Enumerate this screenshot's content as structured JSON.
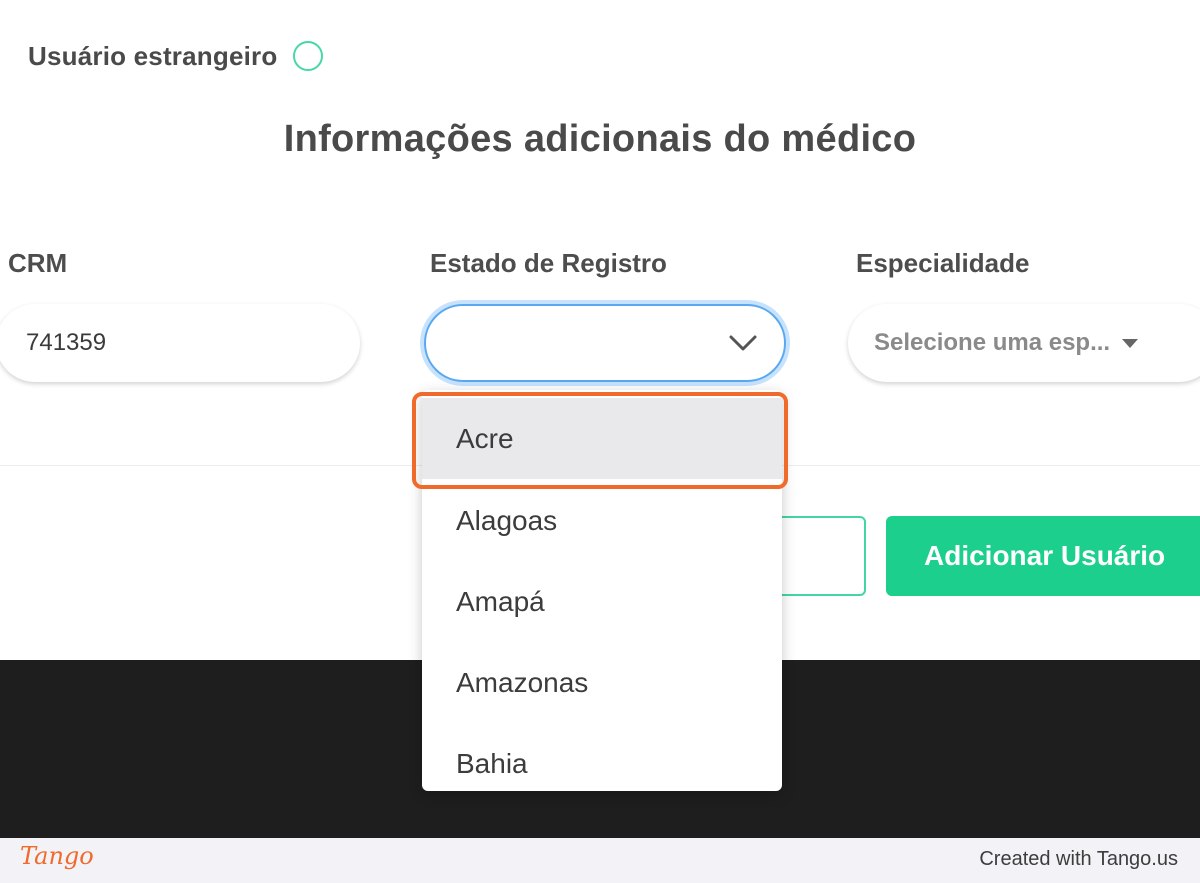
{
  "form": {
    "foreign_user_label": "Usuário estrangeiro",
    "section_title": "Informações adicionais do médico",
    "crm_label": "CRM",
    "crm_value": "741359",
    "estado_label": "Estado de Registro",
    "estado_value": "",
    "especialidade_label": "Especialidade",
    "especialidade_placeholder": "Selecione uma esp..."
  },
  "actions": {
    "cancel_label": "",
    "add_label": "Adicionar Usuário"
  },
  "dropdown": {
    "options": [
      "Acre",
      "Alagoas",
      "Amapá",
      "Amazonas",
      "Bahia"
    ],
    "highlighted_index": 0
  },
  "footer": {
    "logo_text": "Tango",
    "created_with": "Created with Tango.us"
  },
  "colors": {
    "accent_green": "#1ccf8d",
    "focus_blue": "#5aa9f0",
    "highlight_orange": "#f06a2c"
  }
}
